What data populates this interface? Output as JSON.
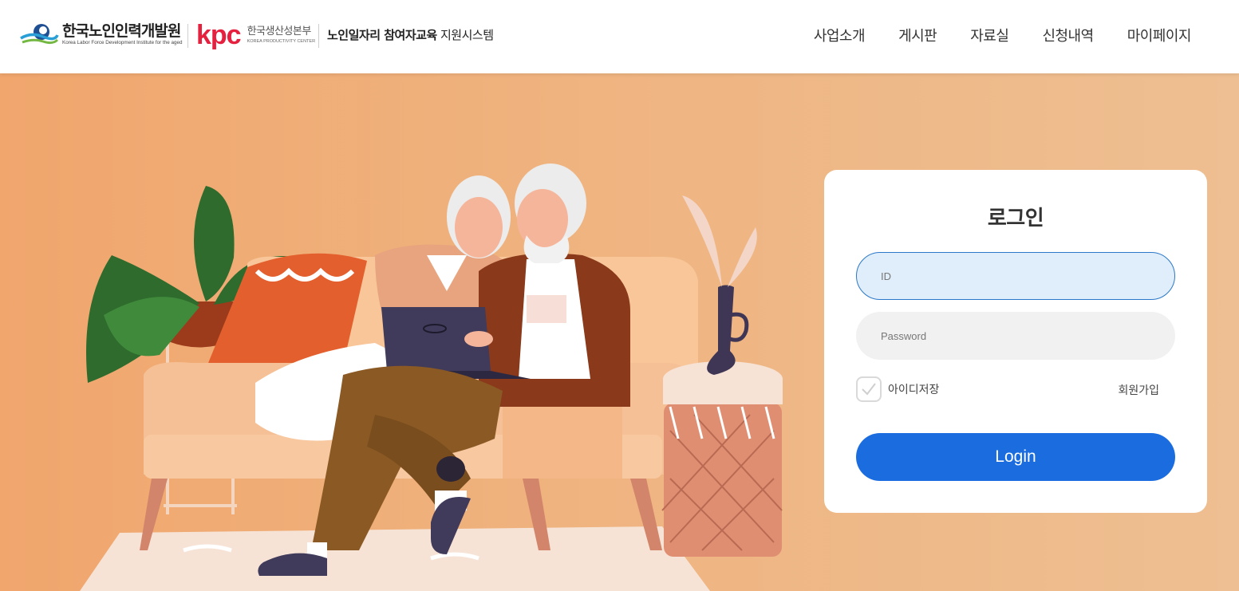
{
  "header": {
    "org_logo": {
      "main": "한국노인인력개발원",
      "sub": "Korea Labor Force Development Institute for the aged"
    },
    "kpc_logo": {
      "mark": "kpc",
      "main": "한국생산성본부",
      "sub": "KOREA PRODUCTIVITY CENTER"
    },
    "system_title_bold": "노인일자리 참여자교육",
    "system_title_rest": " 지원시스템",
    "nav": [
      {
        "label": "사업소개"
      },
      {
        "label": "게시판"
      },
      {
        "label": "자료실"
      },
      {
        "label": "신청내역"
      },
      {
        "label": "마이페이지"
      }
    ]
  },
  "hero": {
    "illustration": "elderly-couple-on-sofa-with-laptop"
  },
  "login": {
    "title": "로그인",
    "id_placeholder": "ID",
    "password_placeholder": "Password",
    "save_id_label": "아이디저장",
    "save_id_checked": false,
    "signup_label": "회원가입",
    "submit_label": "Login"
  },
  "colors": {
    "brand_blue": "#1b6ddf",
    "kpc_red": "#e5213f",
    "hero_bg": "#efb37f"
  }
}
